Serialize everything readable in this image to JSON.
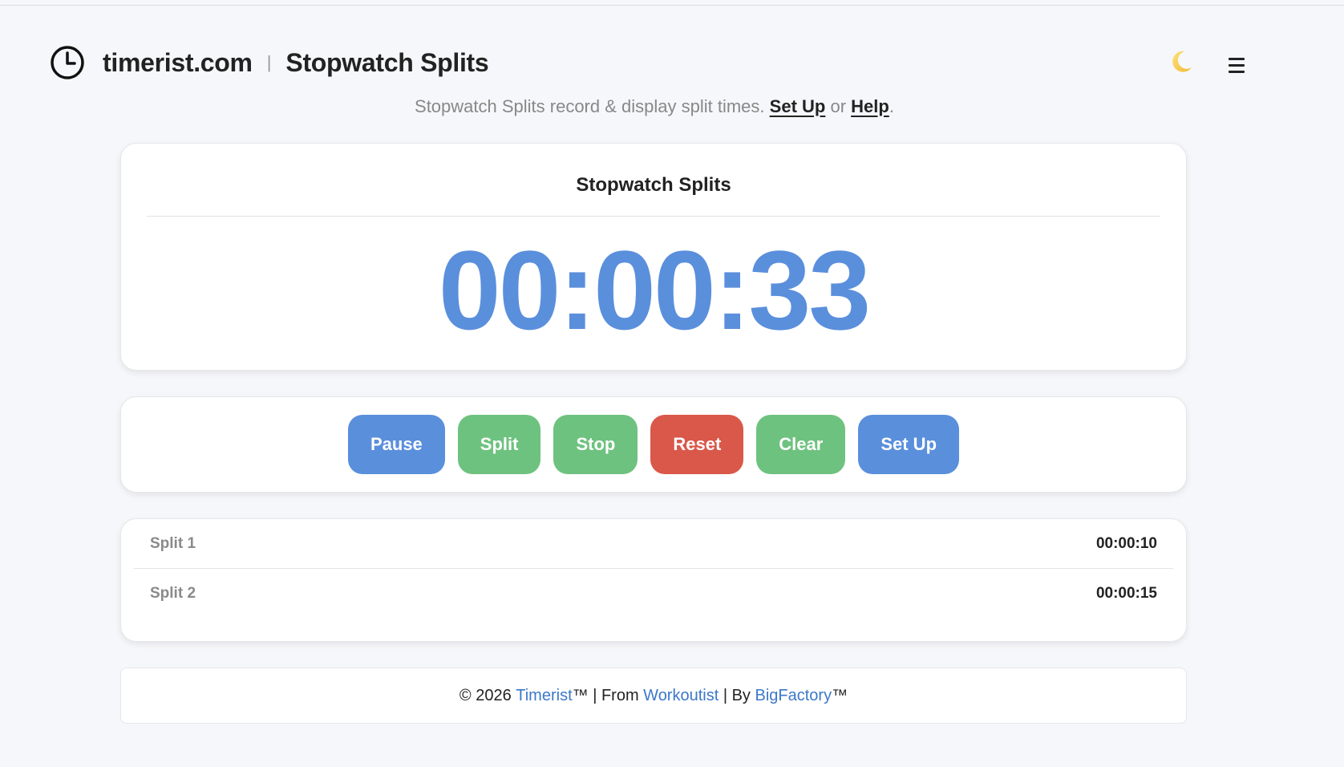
{
  "header": {
    "site_name": "timerist.com",
    "separator": "|",
    "page_name": "Stopwatch Splits",
    "theme_icon": "moon-icon",
    "menu_icon": "hamburger-menu-icon"
  },
  "subtitle": {
    "text": "Stopwatch Splits record & display split times.",
    "setup_link": "Set Up",
    "or": "or",
    "help_link": "Help",
    "period": "."
  },
  "timer": {
    "title": "Stopwatch Splits",
    "display": "00:00:33"
  },
  "controls": {
    "pause": "Pause",
    "split": "Split",
    "stop": "Stop",
    "reset": "Reset",
    "clear": "Clear",
    "setup": "Set Up"
  },
  "splits": [
    {
      "label": "Split 1",
      "time": "00:00:10"
    },
    {
      "label": "Split 2",
      "time": "00:00:15"
    }
  ],
  "footer": {
    "copyright": "© 2026",
    "timerist_link": "Timerist",
    "tm1": "™ | From",
    "workoutist_link": "Workoutist",
    "by": "| By",
    "bigfactory_link": "BigFactory",
    "tm2": "™"
  },
  "colors": {
    "accent_blue": "#5a8fdc",
    "green": "#6ec27f",
    "red": "#d9584a",
    "link_blue": "#3c78c8"
  }
}
